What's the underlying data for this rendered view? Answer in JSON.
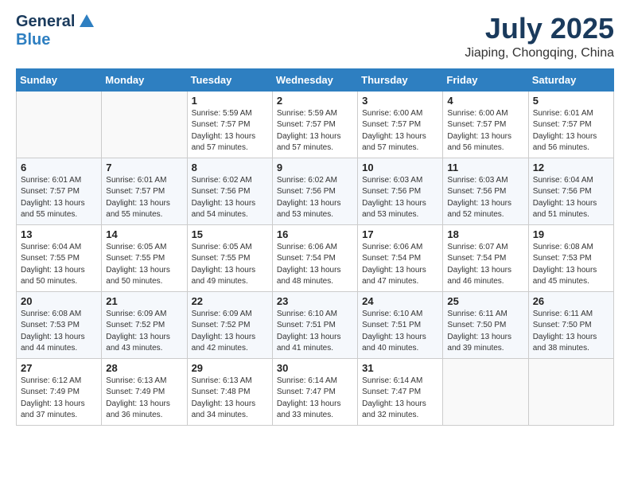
{
  "header": {
    "logo_line1": "General",
    "logo_line2": "Blue",
    "title": "July 2025",
    "subtitle": "Jiaping, Chongqing, China"
  },
  "weekdays": [
    "Sunday",
    "Monday",
    "Tuesday",
    "Wednesday",
    "Thursday",
    "Friday",
    "Saturday"
  ],
  "weeks": [
    [
      {
        "day": "",
        "info": ""
      },
      {
        "day": "",
        "info": ""
      },
      {
        "day": "1",
        "info": "Sunrise: 5:59 AM\nSunset: 7:57 PM\nDaylight: 13 hours\nand 57 minutes."
      },
      {
        "day": "2",
        "info": "Sunrise: 5:59 AM\nSunset: 7:57 PM\nDaylight: 13 hours\nand 57 minutes."
      },
      {
        "day": "3",
        "info": "Sunrise: 6:00 AM\nSunset: 7:57 PM\nDaylight: 13 hours\nand 57 minutes."
      },
      {
        "day": "4",
        "info": "Sunrise: 6:00 AM\nSunset: 7:57 PM\nDaylight: 13 hours\nand 56 minutes."
      },
      {
        "day": "5",
        "info": "Sunrise: 6:01 AM\nSunset: 7:57 PM\nDaylight: 13 hours\nand 56 minutes."
      }
    ],
    [
      {
        "day": "6",
        "info": "Sunrise: 6:01 AM\nSunset: 7:57 PM\nDaylight: 13 hours\nand 55 minutes."
      },
      {
        "day": "7",
        "info": "Sunrise: 6:01 AM\nSunset: 7:57 PM\nDaylight: 13 hours\nand 55 minutes."
      },
      {
        "day": "8",
        "info": "Sunrise: 6:02 AM\nSunset: 7:56 PM\nDaylight: 13 hours\nand 54 minutes."
      },
      {
        "day": "9",
        "info": "Sunrise: 6:02 AM\nSunset: 7:56 PM\nDaylight: 13 hours\nand 53 minutes."
      },
      {
        "day": "10",
        "info": "Sunrise: 6:03 AM\nSunset: 7:56 PM\nDaylight: 13 hours\nand 53 minutes."
      },
      {
        "day": "11",
        "info": "Sunrise: 6:03 AM\nSunset: 7:56 PM\nDaylight: 13 hours\nand 52 minutes."
      },
      {
        "day": "12",
        "info": "Sunrise: 6:04 AM\nSunset: 7:56 PM\nDaylight: 13 hours\nand 51 minutes."
      }
    ],
    [
      {
        "day": "13",
        "info": "Sunrise: 6:04 AM\nSunset: 7:55 PM\nDaylight: 13 hours\nand 50 minutes."
      },
      {
        "day": "14",
        "info": "Sunrise: 6:05 AM\nSunset: 7:55 PM\nDaylight: 13 hours\nand 50 minutes."
      },
      {
        "day": "15",
        "info": "Sunrise: 6:05 AM\nSunset: 7:55 PM\nDaylight: 13 hours\nand 49 minutes."
      },
      {
        "day": "16",
        "info": "Sunrise: 6:06 AM\nSunset: 7:54 PM\nDaylight: 13 hours\nand 48 minutes."
      },
      {
        "day": "17",
        "info": "Sunrise: 6:06 AM\nSunset: 7:54 PM\nDaylight: 13 hours\nand 47 minutes."
      },
      {
        "day": "18",
        "info": "Sunrise: 6:07 AM\nSunset: 7:54 PM\nDaylight: 13 hours\nand 46 minutes."
      },
      {
        "day": "19",
        "info": "Sunrise: 6:08 AM\nSunset: 7:53 PM\nDaylight: 13 hours\nand 45 minutes."
      }
    ],
    [
      {
        "day": "20",
        "info": "Sunrise: 6:08 AM\nSunset: 7:53 PM\nDaylight: 13 hours\nand 44 minutes."
      },
      {
        "day": "21",
        "info": "Sunrise: 6:09 AM\nSunset: 7:52 PM\nDaylight: 13 hours\nand 43 minutes."
      },
      {
        "day": "22",
        "info": "Sunrise: 6:09 AM\nSunset: 7:52 PM\nDaylight: 13 hours\nand 42 minutes."
      },
      {
        "day": "23",
        "info": "Sunrise: 6:10 AM\nSunset: 7:51 PM\nDaylight: 13 hours\nand 41 minutes."
      },
      {
        "day": "24",
        "info": "Sunrise: 6:10 AM\nSunset: 7:51 PM\nDaylight: 13 hours\nand 40 minutes."
      },
      {
        "day": "25",
        "info": "Sunrise: 6:11 AM\nSunset: 7:50 PM\nDaylight: 13 hours\nand 39 minutes."
      },
      {
        "day": "26",
        "info": "Sunrise: 6:11 AM\nSunset: 7:50 PM\nDaylight: 13 hours\nand 38 minutes."
      }
    ],
    [
      {
        "day": "27",
        "info": "Sunrise: 6:12 AM\nSunset: 7:49 PM\nDaylight: 13 hours\nand 37 minutes."
      },
      {
        "day": "28",
        "info": "Sunrise: 6:13 AM\nSunset: 7:49 PM\nDaylight: 13 hours\nand 36 minutes."
      },
      {
        "day": "29",
        "info": "Sunrise: 6:13 AM\nSunset: 7:48 PM\nDaylight: 13 hours\nand 34 minutes."
      },
      {
        "day": "30",
        "info": "Sunrise: 6:14 AM\nSunset: 7:47 PM\nDaylight: 13 hours\nand 33 minutes."
      },
      {
        "day": "31",
        "info": "Sunrise: 6:14 AM\nSunset: 7:47 PM\nDaylight: 13 hours\nand 32 minutes."
      },
      {
        "day": "",
        "info": ""
      },
      {
        "day": "",
        "info": ""
      }
    ]
  ]
}
